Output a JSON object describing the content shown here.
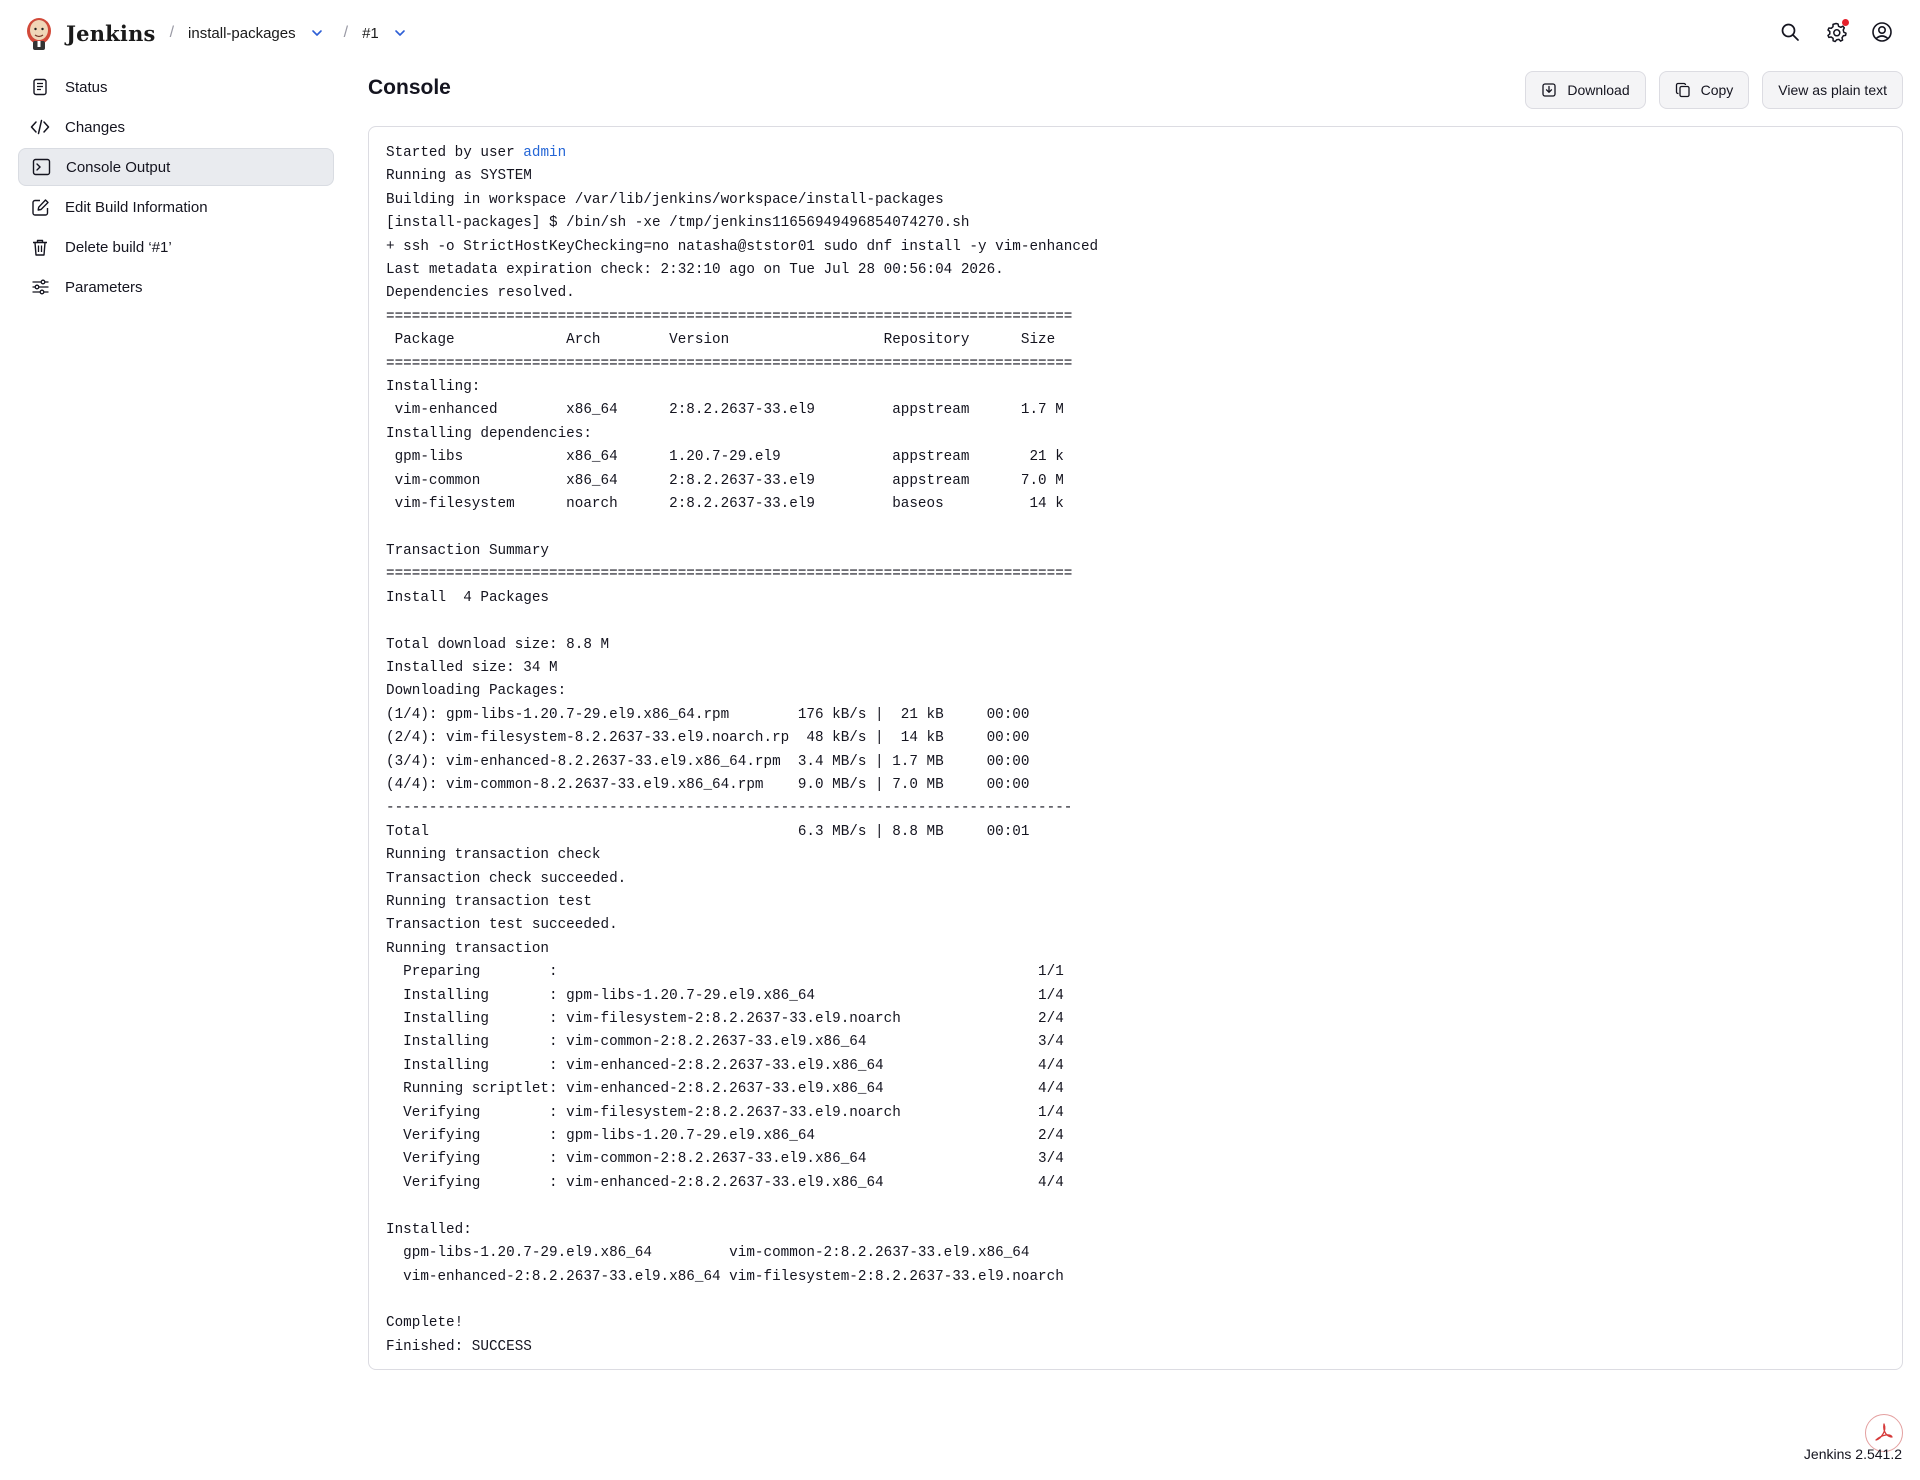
{
  "header": {
    "brand": "Jenkins",
    "breadcrumbs": [
      {
        "label": "install-packages"
      },
      {
        "label": "#1"
      }
    ]
  },
  "sidebar": {
    "items": [
      {
        "label": "Status",
        "icon": "document-icon"
      },
      {
        "label": "Changes",
        "icon": "code-icon"
      },
      {
        "label": "Console Output",
        "icon": "terminal-icon",
        "active": true
      },
      {
        "label": "Edit Build Information",
        "icon": "edit-icon"
      },
      {
        "label": "Delete build ‘#1’",
        "icon": "trash-icon"
      },
      {
        "label": "Parameters",
        "icon": "sliders-icon"
      }
    ]
  },
  "main": {
    "title": "Console",
    "actions": {
      "download": "Download",
      "copy": "Copy",
      "plain": "View as plain text"
    }
  },
  "console": {
    "started_prefix": "Started by user ",
    "user": "admin",
    "body": "Running as SYSTEM\nBuilding in workspace /var/lib/jenkins/workspace/install-packages\n[install-packages] $ /bin/sh -xe /tmp/jenkins11656949496854074270.sh\n+ ssh -o StrictHostKeyChecking=no natasha@ststor01 sudo dnf install -y vim-enhanced\nLast metadata expiration check: 2:32:10 ago on Tue Jul 28 00:56:04 2026.\nDependencies resolved.\n================================================================================\n Package             Arch        Version                  Repository      Size\n================================================================================\nInstalling:\n vim-enhanced        x86_64      2:8.2.2637-33.el9         appstream      1.7 M\nInstalling dependencies:\n gpm-libs            x86_64      1.20.7-29.el9             appstream       21 k\n vim-common          x86_64      2:8.2.2637-33.el9         appstream      7.0 M\n vim-filesystem      noarch      2:8.2.2637-33.el9         baseos          14 k\n\nTransaction Summary\n================================================================================\nInstall  4 Packages\n\nTotal download size: 8.8 M\nInstalled size: 34 M\nDownloading Packages:\n(1/4): gpm-libs-1.20.7-29.el9.x86_64.rpm        176 kB/s |  21 kB     00:00\n(2/4): vim-filesystem-8.2.2637-33.el9.noarch.rp  48 kB/s |  14 kB     00:00\n(3/4): vim-enhanced-8.2.2637-33.el9.x86_64.rpm  3.4 MB/s | 1.7 MB     00:00\n(4/4): vim-common-8.2.2637-33.el9.x86_64.rpm    9.0 MB/s | 7.0 MB     00:00\n--------------------------------------------------------------------------------\nTotal                                           6.3 MB/s | 8.8 MB     00:01\nRunning transaction check\nTransaction check succeeded.\nRunning transaction test\nTransaction test succeeded.\nRunning transaction\n  Preparing        :                                                        1/1\n  Installing       : gpm-libs-1.20.7-29.el9.x86_64                          1/4\n  Installing       : vim-filesystem-2:8.2.2637-33.el9.noarch                2/4\n  Installing       : vim-common-2:8.2.2637-33.el9.x86_64                    3/4\n  Installing       : vim-enhanced-2:8.2.2637-33.el9.x86_64                  4/4\n  Running scriptlet: vim-enhanced-2:8.2.2637-33.el9.x86_64                  4/4\n  Verifying        : vim-filesystem-2:8.2.2637-33.el9.noarch                1/4\n  Verifying        : gpm-libs-1.20.7-29.el9.x86_64                          2/4\n  Verifying        : vim-common-2:8.2.2637-33.el9.x86_64                    3/4\n  Verifying        : vim-enhanced-2:8.2.2637-33.el9.x86_64                  4/4\n\nInstalled:\n  gpm-libs-1.20.7-29.el9.x86_64         vim-common-2:8.2.2637-33.el9.x86_64\n  vim-enhanced-2:8.2.2637-33.el9.x86_64 vim-filesystem-2:8.2.2637-33.el9.noarch\n\nComplete!\nFinished: SUCCESS"
  },
  "footer": {
    "version": "Jenkins 2.541.2"
  },
  "colors": {
    "link": "#2566d6",
    "notification": "#e5202b",
    "active_bg": "#e9ebef"
  }
}
